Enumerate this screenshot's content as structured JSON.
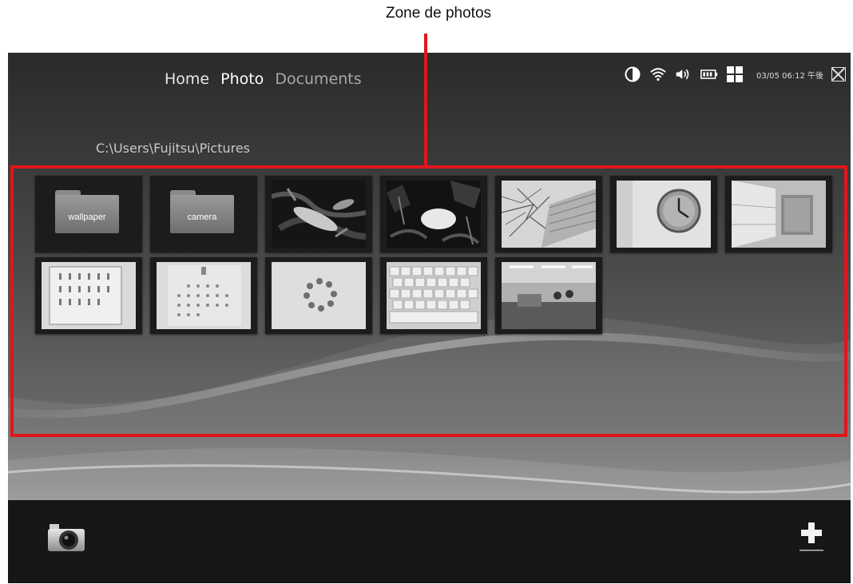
{
  "annotation": {
    "label": "Zone de photos"
  },
  "nav": {
    "home": "Home",
    "photo": "Photo",
    "documents": "Documents"
  },
  "status": {
    "datetime": "03/05 06:12 午後"
  },
  "path": "C:\\Users\\Fujitsu\\Pictures",
  "folders": [
    {
      "label": "wallpaper",
      "icon": "folder-icon"
    },
    {
      "label": "camera",
      "icon": "folder-icon"
    }
  ],
  "photos": [
    "koi-fish",
    "white-koi",
    "tree-building",
    "wall-clock",
    "window-room",
    "wall-calendar",
    "calendar-page",
    "circle-dots",
    "keyboard",
    "office-room"
  ],
  "icons": {
    "contrast": "contrast-icon",
    "wifi": "wifi-icon",
    "volume": "volume-icon",
    "battery": "battery-icon",
    "grid": "grid-icon",
    "close": "close-icon",
    "camera": "camera-icon",
    "add": "plus-icon"
  },
  "colors": {
    "callout": "#e0161b",
    "bottom_bar": "#161616"
  }
}
